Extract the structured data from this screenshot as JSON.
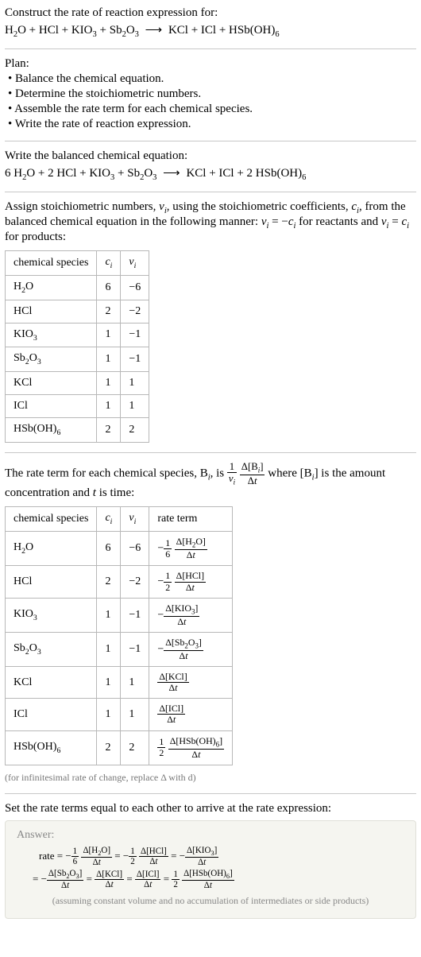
{
  "intro": {
    "line1": "Construct the rate of reaction expression for:",
    "eq_lhs": "H₂O + HCl + KIO₃ + Sb₂O₃",
    "eq_rhs": "KCl + ICl + HSb(OH)₆"
  },
  "plan": {
    "title": "Plan:",
    "items": [
      "• Balance the chemical equation.",
      "• Determine the stoichiometric numbers.",
      "• Assemble the rate term for each chemical species.",
      "• Write the rate of reaction expression."
    ]
  },
  "balanced": {
    "intro": "Write the balanced chemical equation:",
    "eq_lhs": "6 H₂O + 2 HCl + KIO₃ + Sb₂O₃",
    "eq_rhs": "KCl + ICl + 2 HSb(OH)₆"
  },
  "assign_text": "Assign stoichiometric numbers, νᵢ, using the stoichiometric coefficients, cᵢ, from the balanced chemical equation in the following manner: νᵢ = −cᵢ for reactants and νᵢ = cᵢ for products:",
  "stoich_table": {
    "headers": [
      "chemical species",
      "cᵢ",
      "νᵢ"
    ],
    "rows": [
      {
        "sp": "H₂O",
        "c": "6",
        "v": "−6"
      },
      {
        "sp": "HCl",
        "c": "2",
        "v": "−2"
      },
      {
        "sp": "KIO₃",
        "c": "1",
        "v": "−1"
      },
      {
        "sp": "Sb₂O₃",
        "c": "1",
        "v": "−1"
      },
      {
        "sp": "KCl",
        "c": "1",
        "v": "1"
      },
      {
        "sp": "ICl",
        "c": "1",
        "v": "1"
      },
      {
        "sp": "HSb(OH)₆",
        "c": "2",
        "v": "2"
      }
    ]
  },
  "rate_intro_a": "The rate term for each chemical species, Bᵢ, is ",
  "rate_intro_b": " where [Bᵢ] is the amount",
  "rate_intro_c": "concentration and t is time:",
  "rate_table": {
    "headers": [
      "chemical species",
      "cᵢ",
      "νᵢ",
      "rate term"
    ],
    "rows": [
      {
        "sp": "H₂O",
        "c": "6",
        "v": "−6",
        "coef": "−",
        "fnum": "1",
        "fden": "6",
        "dnum": "Δ[H₂O]",
        "dden": "Δt"
      },
      {
        "sp": "HCl",
        "c": "2",
        "v": "−2",
        "coef": "−",
        "fnum": "1",
        "fden": "2",
        "dnum": "Δ[HCl]",
        "dden": "Δt"
      },
      {
        "sp": "KIO₃",
        "c": "1",
        "v": "−1",
        "coef": "−",
        "fnum": "",
        "fden": "",
        "dnum": "Δ[KIO₃]",
        "dden": "Δt"
      },
      {
        "sp": "Sb₂O₃",
        "c": "1",
        "v": "−1",
        "coef": "−",
        "fnum": "",
        "fden": "",
        "dnum": "Δ[Sb₂O₃]",
        "dden": "Δt"
      },
      {
        "sp": "KCl",
        "c": "1",
        "v": "1",
        "coef": "",
        "fnum": "",
        "fden": "",
        "dnum": "Δ[KCl]",
        "dden": "Δt"
      },
      {
        "sp": "ICl",
        "c": "1",
        "v": "1",
        "coef": "",
        "fnum": "",
        "fden": "",
        "dnum": "Δ[ICl]",
        "dden": "Δt"
      },
      {
        "sp": "HSb(OH)₆",
        "c": "2",
        "v": "2",
        "coef": "",
        "fnum": "1",
        "fden": "2",
        "dnum": "Δ[HSb(OH)₆]",
        "dden": "Δt"
      }
    ]
  },
  "note": "(for infinitesimal rate of change, replace Δ with d)",
  "final_intro": "Set the rate terms equal to each other to arrive at the rate expression:",
  "answer": {
    "label": "Answer:",
    "assume": "(assuming constant volume and no accumulation of intermediates or side products)"
  }
}
